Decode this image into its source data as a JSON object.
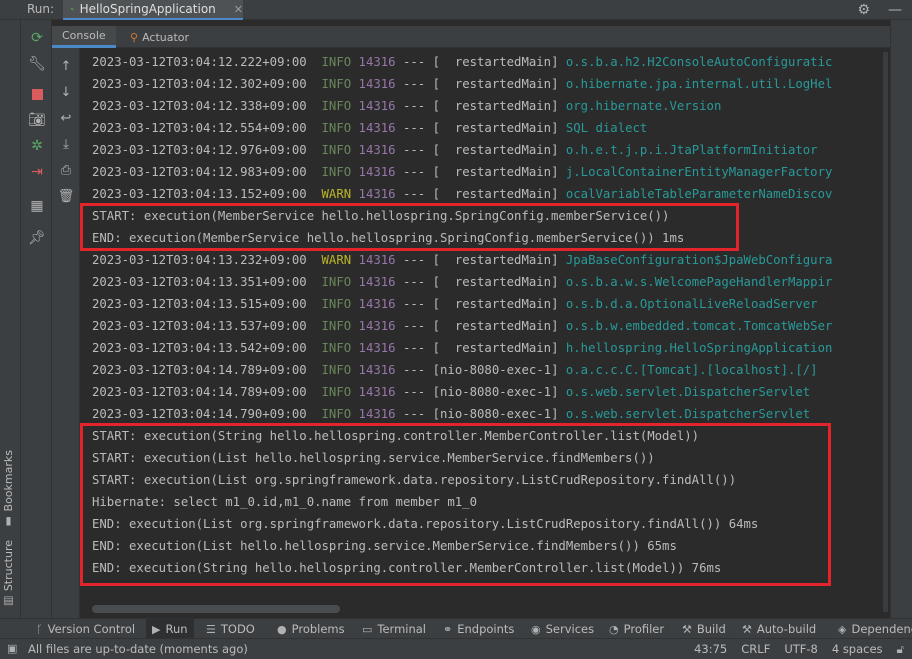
{
  "header": {
    "run_label": "Run:",
    "run_config": "HelloSpringApplication",
    "settings_icon": "gear-icon",
    "hide_icon": "minimize-icon"
  },
  "subtabs": [
    {
      "label": "Console",
      "active": true
    },
    {
      "label": "Actuator",
      "active": false
    }
  ],
  "left_stripe": {
    "bookmarks": "Bookmarks",
    "structure": "Structure"
  },
  "console_lines": [
    {
      "ts": "2023-03-12T03:04:12.222+09:00",
      "level": "INFO",
      "pid": "14316",
      "sep": "---",
      "thread": "[  restartedMain]",
      "logger": "o.s.b.a.h2.H2ConsoleAutoConfiguratic"
    },
    {
      "ts": "2023-03-12T03:04:12.302+09:00",
      "level": "INFO",
      "pid": "14316",
      "sep": "---",
      "thread": "[  restartedMain]",
      "logger": "o.hibernate.jpa.internal.util.LogHel"
    },
    {
      "ts": "2023-03-12T03:04:12.338+09:00",
      "level": "INFO",
      "pid": "14316",
      "sep": "---",
      "thread": "[  restartedMain]",
      "logger": "org.hibernate.Version"
    },
    {
      "ts": "2023-03-12T03:04:12.554+09:00",
      "level": "INFO",
      "pid": "14316",
      "sep": "---",
      "thread": "[  restartedMain]",
      "logger": "SQL dialect"
    },
    {
      "ts": "2023-03-12T03:04:12.976+09:00",
      "level": "INFO",
      "pid": "14316",
      "sep": "---",
      "thread": "[  restartedMain]",
      "logger": "o.h.e.t.j.p.i.JtaPlatformInitiator"
    },
    {
      "ts": "2023-03-12T03:04:12.983+09:00",
      "level": "INFO",
      "pid": "14316",
      "sep": "---",
      "thread": "[  restartedMain]",
      "logger": "j.LocalContainerEntityManagerFactory"
    },
    {
      "ts": "2023-03-12T03:04:13.152+09:00",
      "level": "WARN",
      "pid": "14316",
      "sep": "---",
      "thread": "[  restartedMain]",
      "logger": "ocalVariableTableParameterNameDiscov"
    }
  ],
  "aop_block_1": [
    "START: execution(MemberService hello.hellospring.SpringConfig.memberService())",
    "END: execution(MemberService hello.hellospring.SpringConfig.memberService()) 1ms"
  ],
  "console_lines_2": [
    {
      "ts": "2023-03-12T03:04:13.232+09:00",
      "level": "WARN",
      "pid": "14316",
      "sep": "---",
      "thread": "[  restartedMain]",
      "logger": "JpaBaseConfiguration$JpaWebConfigura"
    },
    {
      "ts": "2023-03-12T03:04:13.351+09:00",
      "level": "INFO",
      "pid": "14316",
      "sep": "---",
      "thread": "[  restartedMain]",
      "logger": "o.s.b.a.w.s.WelcomePageHandlerMappir"
    },
    {
      "ts": "2023-03-12T03:04:13.515+09:00",
      "level": "INFO",
      "pid": "14316",
      "sep": "---",
      "thread": "[  restartedMain]",
      "logger": "o.s.b.d.a.OptionalLiveReloadServer"
    },
    {
      "ts": "2023-03-12T03:04:13.537+09:00",
      "level": "INFO",
      "pid": "14316",
      "sep": "---",
      "thread": "[  restartedMain]",
      "logger": "o.s.b.w.embedded.tomcat.TomcatWebSer"
    },
    {
      "ts": "2023-03-12T03:04:13.542+09:00",
      "level": "INFO",
      "pid": "14316",
      "sep": "---",
      "thread": "[  restartedMain]",
      "logger": "h.hellospring.HelloSpringApplication"
    },
    {
      "ts": "2023-03-12T03:04:14.789+09:00",
      "level": "INFO",
      "pid": "14316",
      "sep": "---",
      "thread": "[nio-8080-exec-1]",
      "logger": "o.a.c.c.C.[Tomcat].[localhost].[/]"
    },
    {
      "ts": "2023-03-12T03:04:14.789+09:00",
      "level": "INFO",
      "pid": "14316",
      "sep": "---",
      "thread": "[nio-8080-exec-1]",
      "logger": "o.s.web.servlet.DispatcherServlet"
    },
    {
      "ts": "2023-03-12T03:04:14.790+09:00",
      "level": "INFO",
      "pid": "14316",
      "sep": "---",
      "thread": "[nio-8080-exec-1]",
      "logger": "o.s.web.servlet.DispatcherServlet"
    }
  ],
  "aop_block_2": [
    "START: execution(String hello.hellospring.controller.MemberController.list(Model))",
    "START: execution(List hello.hellospring.service.MemberService.findMembers())",
    "START: execution(List org.springframework.data.repository.ListCrudRepository.findAll())",
    "Hibernate: select m1_0.id,m1_0.name from member m1_0",
    "END: execution(List org.springframework.data.repository.ListCrudRepository.findAll()) 64ms",
    "END: execution(List hello.hellospring.service.MemberService.findMembers()) 65ms",
    "END: execution(String hello.hellospring.controller.MemberController.list(Model)) 76ms"
  ],
  "bottom_tabs": [
    {
      "label": "Version Control",
      "icon": "branch-icon"
    },
    {
      "label": "Run",
      "icon": "run-icon",
      "active": true
    },
    {
      "label": "TODO",
      "icon": "list-icon"
    },
    {
      "label": "Problems",
      "icon": "problems-icon"
    },
    {
      "label": "Terminal",
      "icon": "terminal-icon"
    },
    {
      "label": "Endpoints",
      "icon": "endpoints-icon"
    },
    {
      "label": "Services",
      "icon": "services-icon"
    },
    {
      "label": "Profiler",
      "icon": "profiler-icon"
    },
    {
      "label": "Build",
      "icon": "build-icon"
    },
    {
      "label": "Auto-build",
      "icon": "hammer-icon"
    },
    {
      "label": "Dependenc",
      "icon": "dependencies-icon"
    }
  ],
  "status": {
    "message": "All files are up-to-date (moments ago)",
    "position": "43:75",
    "line_sep": "CRLF",
    "encoding": "UTF-8",
    "indent": "4 spaces"
  },
  "colors": {
    "info": "#6a8759",
    "warn": "#bbb529",
    "pid": "#9876aa",
    "logger": "#299999",
    "highlight": "#e3242b"
  }
}
